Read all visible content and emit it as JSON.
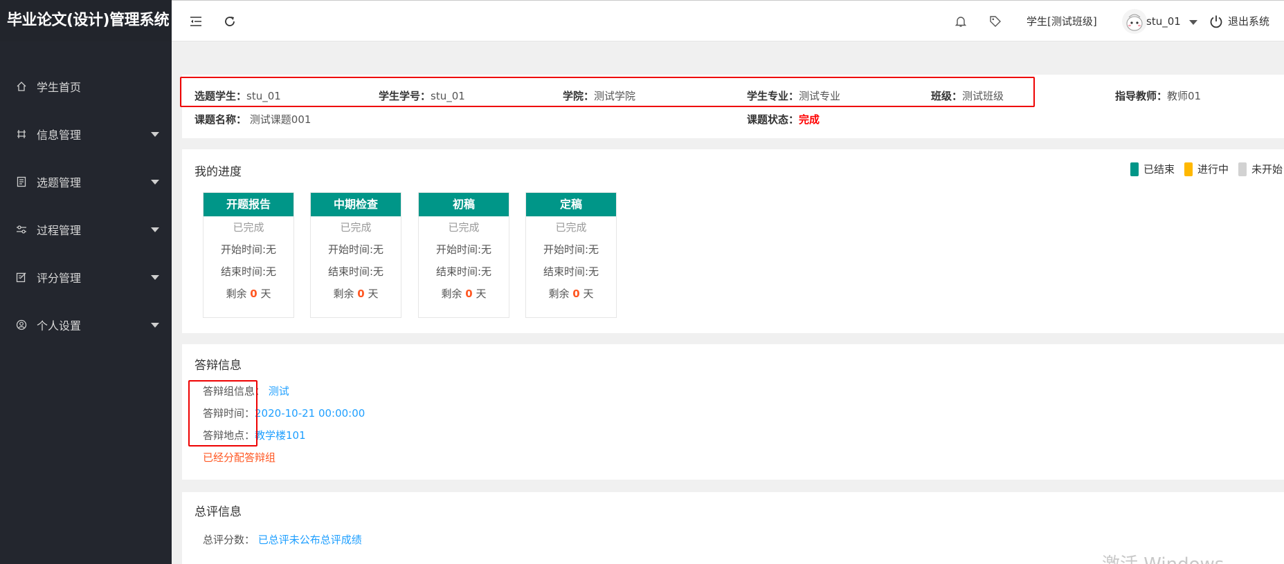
{
  "app": {
    "title": "毕业论文(设计)管理系统"
  },
  "sidebar": {
    "items": [
      {
        "label": "学生首页",
        "icon": "home-icon",
        "has_arrow": false
      },
      {
        "label": "信息管理",
        "icon": "grid-icon",
        "has_arrow": true
      },
      {
        "label": "选题管理",
        "icon": "document-icon",
        "has_arrow": true
      },
      {
        "label": "过程管理",
        "icon": "sliders-icon",
        "has_arrow": true
      },
      {
        "label": "评分管理",
        "icon": "edit-icon",
        "has_arrow": true
      },
      {
        "label": "个人设置",
        "icon": "user-circle-icon",
        "has_arrow": true
      }
    ]
  },
  "header": {
    "role": "学生[测试班级]",
    "username": "stu_01",
    "logout": "退出系统",
    "icons": [
      "menu-fold-icon",
      "refresh-icon",
      "bell-icon",
      "tag-icon",
      "power-icon"
    ]
  },
  "student_info": {
    "student": {
      "label": "选题学生：",
      "value": "stu_01"
    },
    "student_id": {
      "label": "学生学号：",
      "value": "stu_01"
    },
    "college": {
      "label": "学院：",
      "value": "测试学院"
    },
    "major": {
      "label": "学生专业：",
      "value": "测试专业"
    },
    "class": {
      "label": "班级：",
      "value": "测试班级"
    },
    "teacher": {
      "label": "指导教师：",
      "value": "教师01"
    },
    "topic": {
      "label": "课题名称：",
      "value": "测试课题001"
    },
    "topic_status": {
      "label": "课题状态：",
      "value": "完成"
    }
  },
  "progress": {
    "title": "我的进度",
    "legend": [
      {
        "label": "已结束",
        "color": "#009688"
      },
      {
        "label": "进行中",
        "color": "#ffb800"
      },
      {
        "label": "未开始",
        "color": "#d2d2d2"
      }
    ],
    "stages": [
      {
        "name": "开题报告",
        "status": "已完成",
        "start": "开始时间:无",
        "end": "结束时间:无",
        "remain_prefix": "剩余",
        "remain": "0",
        "remain_suffix": "天"
      },
      {
        "name": "中期检查",
        "status": "已完成",
        "start": "开始时间:无",
        "end": "结束时间:无",
        "remain_prefix": "剩余",
        "remain": "0",
        "remain_suffix": "天"
      },
      {
        "name": "初稿",
        "status": "已完成",
        "start": "开始时间:无",
        "end": "结束时间:无",
        "remain_prefix": "剩余",
        "remain": "0",
        "remain_suffix": "天"
      },
      {
        "name": "定稿",
        "status": "已完成",
        "start": "开始时间:无",
        "end": "结束时间:无",
        "remain_prefix": "剩余",
        "remain": "0",
        "remain_suffix": "天"
      }
    ]
  },
  "defense": {
    "title": "答辩信息",
    "group": {
      "label": "答辩组信息：",
      "value": "测试"
    },
    "time": {
      "label": "答辩时间：",
      "value": "2020-10-21 00:00:00"
    },
    "place": {
      "label": "答辩地点：",
      "value": "教学楼101"
    },
    "note": "已经分配答辩组"
  },
  "evaluation": {
    "title": "总评信息",
    "score": {
      "label": "总评分数：",
      "value": "已总评未公布总评成绩"
    }
  },
  "watermark": "激活 Windows"
}
